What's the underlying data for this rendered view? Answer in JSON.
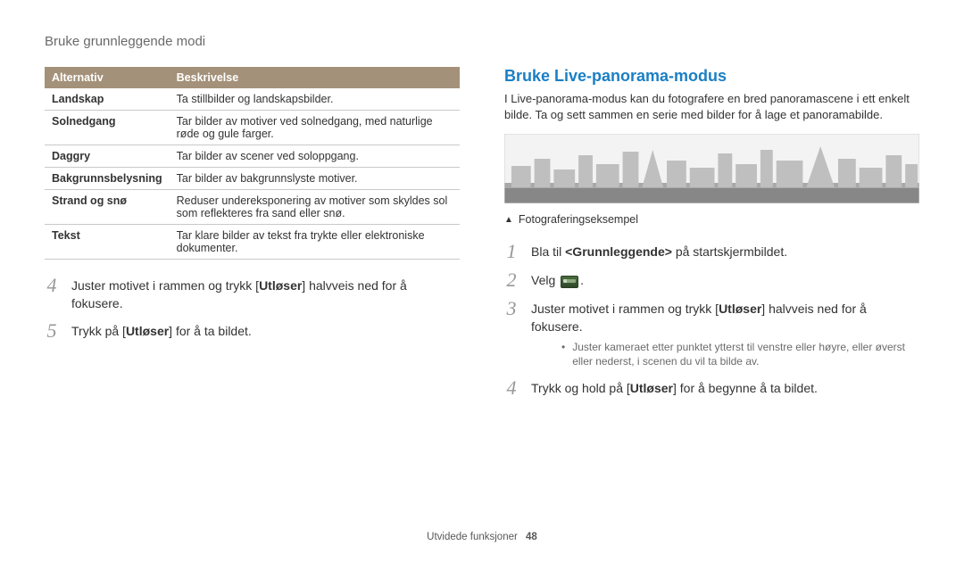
{
  "header": "Bruke grunnleggende modi",
  "table": {
    "head": {
      "c1": "Alternativ",
      "c2": "Beskrivelse"
    },
    "rows": [
      {
        "opt": "Landskap",
        "desc": "Ta stillbilder og landskapsbilder."
      },
      {
        "opt": "Solnedgang",
        "desc": "Tar bilder av motiver ved solnedgang, med naturlige røde og gule farger."
      },
      {
        "opt": "Daggry",
        "desc": "Tar bilder av scener ved soloppgang."
      },
      {
        "opt": "Bakgrunnsbelysning",
        "desc": "Tar bilder av bakgrunnslyste motiver."
      },
      {
        "opt": "Strand og snø",
        "desc": "Reduser undereksponering av motiver som skyldes sol som reflekteres fra sand eller snø."
      },
      {
        "opt": "Tekst",
        "desc": "Tar klare bilder av tekst fra trykte eller elektroniske dokumenter."
      }
    ]
  },
  "left_steps": {
    "s4_a": "Juster motivet i rammen og trykk [",
    "s4_b": "Utløser",
    "s4_c": "] halvveis ned for å fokusere.",
    "s5_a": "Trykk på [",
    "s5_b": "Utløser",
    "s5_c": "] for å ta bildet."
  },
  "nums": {
    "n1": "1",
    "n2": "2",
    "n3": "3",
    "n4": "4",
    "n5": "5"
  },
  "right": {
    "heading": "Bruke Live-panorama-modus",
    "intro": "I Live-panorama-modus kan du fotografere en bred panoramascene i ett enkelt bilde. Ta og sett sammen en serie med bilder for å lage et panoramabilde.",
    "caption": "Fotograferingseksempel",
    "s1_a": "Bla til ",
    "s1_b": "<Grunnleggende>",
    "s1_c": " på startskjermbildet.",
    "s2": "Velg ",
    "s2_end": ".",
    "s3_a": "Juster motivet i rammen og trykk [",
    "s3_b": "Utløser",
    "s3_c": "] halvveis ned for å fokusere.",
    "s3_sub": "Juster kameraet etter punktet ytterst til venstre eller høyre, eller øverst eller nederst, i scenen du vil ta bilde av.",
    "s4_a": "Trykk og hold på [",
    "s4_b": "Utløser",
    "s4_c": "] for å begynne å ta bildet."
  },
  "footer": {
    "section": "Utvidede funksjoner",
    "page": "48"
  }
}
